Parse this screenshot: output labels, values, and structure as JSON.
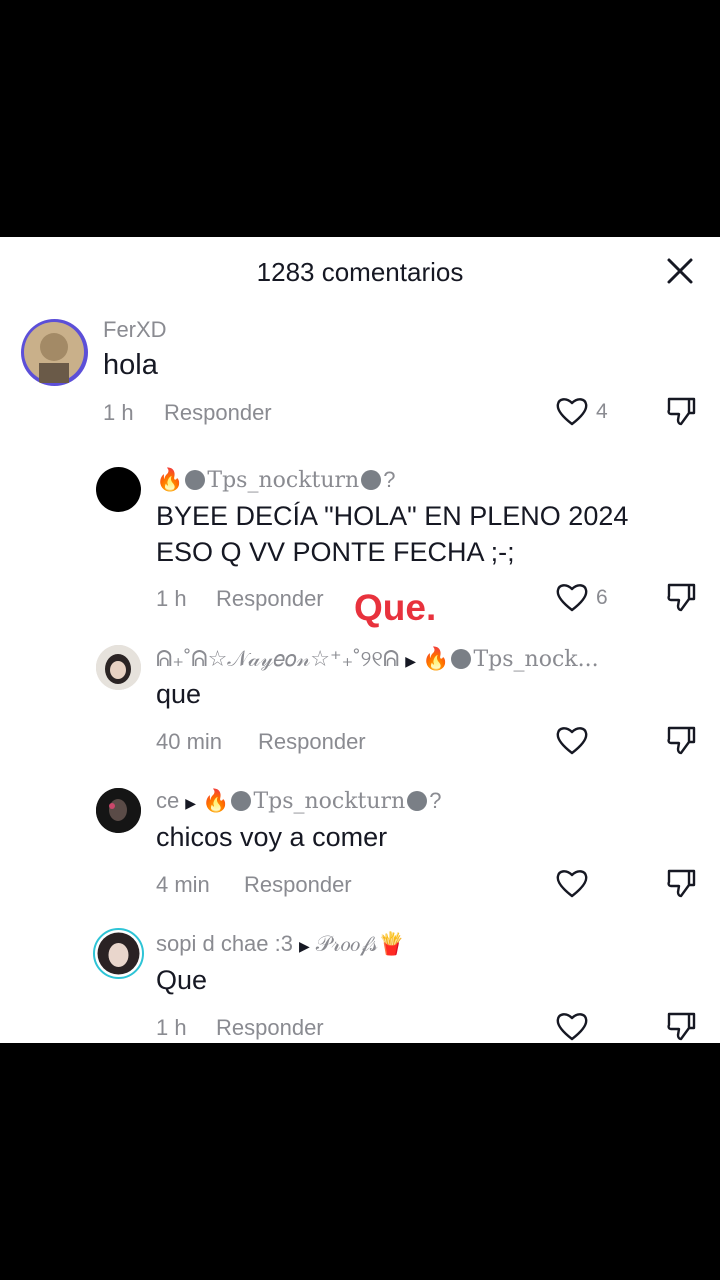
{
  "header": {
    "title": "1283 comentarios",
    "close_icon": "close-icon"
  },
  "overlay_text": "Que.",
  "comments": [
    {
      "username": "FerXD",
      "text": "hola",
      "time": "1 h",
      "reply": "Responder",
      "likes": "4"
    },
    {
      "username_prefix": "🔥",
      "username_main": "Tps_nockturn",
      "username_suffix": "?",
      "text": "BYEE DECÍA \"HOLA\" EN PLENO 2024 ESO Q VV PONTE FECHA ;-;",
      "time": "1 h",
      "reply": "Responder",
      "likes": "6"
    },
    {
      "username": "ᕱ₊˚ᕱ☆𝒩𝒶𝓎𝑒𝑜𝓃☆⁺₊˚୨୧ᕱ",
      "reply_to_prefix": "🔥",
      "reply_to": "Tps_nock...",
      "text": "que",
      "time": "40 min",
      "reply": "Responder"
    },
    {
      "username": "ce",
      "reply_to_prefix": "🔥",
      "reply_to": "Tps_nockturn",
      "reply_to_suffix": "?",
      "text": "chicos voy a comer",
      "time": "4 min",
      "reply": "Responder"
    },
    {
      "username": "sopi d chae :3",
      "reply_to": "𝒫𝓇𝑜𝑜𝒻𝓈🍟",
      "text": "Que",
      "time": "1 h",
      "reply": "Responder"
    }
  ]
}
